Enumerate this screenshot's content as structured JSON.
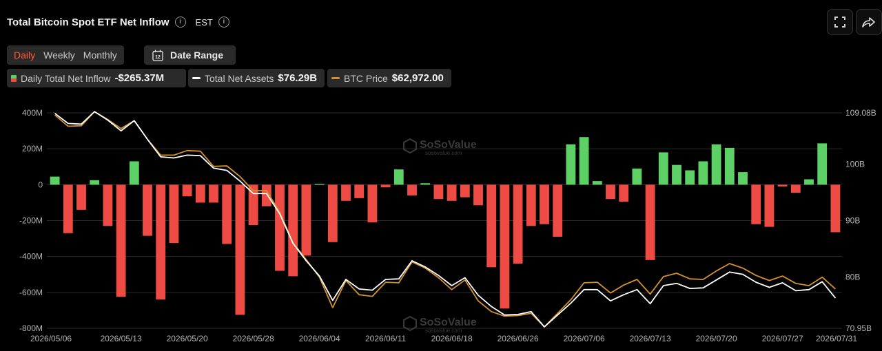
{
  "header": {
    "title": "Total Bitcoin Spot ETF Net Inflow",
    "timezone": "EST"
  },
  "tabs": [
    {
      "label": "Daily",
      "active": true
    },
    {
      "label": "Weekly",
      "active": false
    },
    {
      "label": "Monthly",
      "active": false
    }
  ],
  "date_range": {
    "label": "Date Range",
    "icon": "calendar-icon",
    "icon_text": "12"
  },
  "legend": {
    "inflow_label": "Daily Total Net Inflow",
    "inflow_value": "-$265.37M",
    "assets_label": "Total Net Assets",
    "assets_value": "$76.29B",
    "btc_label": "BTC Price",
    "btc_value": "$62,972.00"
  },
  "watermark": {
    "brand": "SoSoValue",
    "site": "sosovalue.com"
  },
  "colors": {
    "positive": "#5dd066",
    "negative": "#ef4b45",
    "assets_line": "#ffffff",
    "btc_line": "#d4922e",
    "grid": "#2b2b2b",
    "background": "#000000"
  },
  "chart_data": {
    "type": "bar",
    "title": "Total Bitcoin Spot ETF Net Inflow",
    "x_tick_labels": [
      "2026/05/06",
      "2026/05/13",
      "2026/05/20",
      "2026/05/28",
      "2026/06/04",
      "2026/06/11",
      "2026/06/18",
      "2026/06/26",
      "2026/07/06",
      "2026/07/13",
      "2026/07/20",
      "2026/07/27",
      "2026/07/31"
    ],
    "x_tick_index": [
      0,
      5,
      10,
      15,
      20,
      25,
      30,
      35,
      40,
      45,
      50,
      55,
      59
    ],
    "y_left": {
      "ticks": [
        "400M",
        "200M",
        "0",
        "-200M",
        "-400M",
        "-600M",
        "-800M"
      ],
      "range": [
        -800,
        400
      ],
      "unit": "M USD"
    },
    "y_right": {
      "ticks": [
        "109.08B",
        "100B",
        "90B",
        "80B",
        "70.95B"
      ],
      "range": [
        70.95,
        109.08
      ],
      "unit": "B USD"
    },
    "grid": true,
    "series": [
      {
        "name": "Daily Total Net Inflow",
        "type": "bar",
        "unit": "M",
        "values": [
          45,
          -270,
          -140,
          25,
          -230,
          -625,
          130,
          -285,
          -640,
          -325,
          -65,
          -100,
          -100,
          -330,
          -725,
          -225,
          -120,
          -480,
          -510,
          -395,
          5,
          -320,
          -90,
          -75,
          -210,
          -15,
          85,
          -60,
          8,
          -80,
          -90,
          -70,
          -115,
          -460,
          -690,
          -440,
          -230,
          -220,
          -290,
          225,
          265,
          20,
          -80,
          -95,
          90,
          -420,
          180,
          110,
          80,
          130,
          225,
          205,
          70,
          -220,
          -235,
          -10,
          -45,
          30,
          230,
          -265
        ]
      },
      {
        "name": "Total Net Assets",
        "type": "line",
        "axis": "right",
        "unit": "B",
        "values": [
          109.0,
          107.2,
          107.1,
          109.3,
          107.8,
          105.9,
          107.7,
          104.4,
          101.3,
          101.1,
          101.6,
          101.5,
          99.3,
          98.9,
          97.0,
          94.8,
          94.8,
          91.2,
          86.0,
          82.9,
          80.2,
          75.9,
          79.6,
          77.9,
          77.7,
          79.6,
          79.7,
          82.9,
          81.8,
          80.3,
          78.5,
          79.9,
          76.8,
          74.8,
          73.3,
          73.4,
          73.9,
          71.2,
          73.3,
          75.4,
          77.8,
          77.8,
          75.8,
          76.9,
          77.8,
          75.3,
          78.5,
          78.9,
          78.0,
          78.1,
          79.5,
          80.9,
          80.5,
          79.1,
          78.2,
          79.0,
          77.6,
          77.8,
          79.2,
          76.3
        ]
      },
      {
        "name": "BTC Price",
        "type": "line",
        "axis": "right",
        "unit": "B (right axis scale)",
        "values": [
          108.7,
          106.7,
          106.8,
          109.3,
          107.9,
          106.3,
          107.7,
          104.4,
          101.6,
          101.6,
          102.4,
          102.3,
          99.6,
          99.7,
          97.8,
          95.3,
          95.3,
          91.5,
          86.1,
          83.1,
          80.0,
          74.6,
          79.4,
          76.9,
          76.6,
          79.1,
          79.0,
          82.7,
          81.6,
          79.9,
          77.8,
          79.5,
          75.8,
          73.9,
          73.1,
          73.2,
          73.6,
          71.2,
          73.6,
          76.0,
          79.0,
          79.1,
          77.2,
          78.6,
          79.6,
          77.0,
          80.1,
          80.7,
          79.7,
          79.6,
          81.1,
          82.4,
          81.6,
          80.3,
          79.4,
          80.2,
          78.9,
          78.5,
          80.0,
          77.9
        ]
      }
    ]
  }
}
